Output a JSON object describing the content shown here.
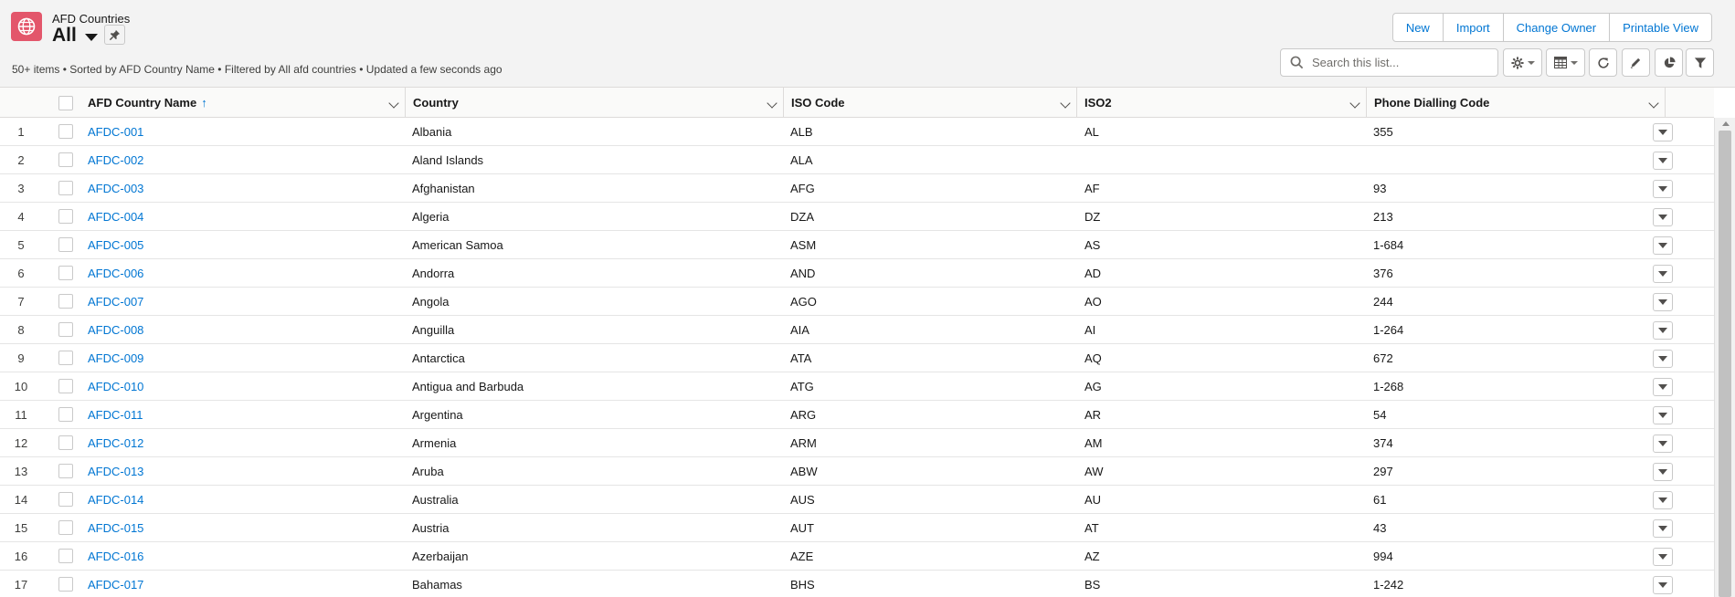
{
  "header": {
    "object_type": "AFD Countries",
    "view_name": "All",
    "meta": "50+ items • Sorted by AFD Country Name • Filtered by All afd countries • Updated a few seconds ago"
  },
  "actions": [
    {
      "name": "new-button",
      "label": "New"
    },
    {
      "name": "import-button",
      "label": "Import"
    },
    {
      "name": "change-owner-button",
      "label": "Change Owner"
    },
    {
      "name": "printable-view-button",
      "label": "Printable View"
    }
  ],
  "search": {
    "placeholder": "Search this list..."
  },
  "columns": {
    "name": "AFD Country Name",
    "country": "Country",
    "iso": "ISO Code",
    "iso2": "ISO2",
    "phone": "Phone Dialling Code",
    "sort_indicator": "↑"
  },
  "rows": [
    {
      "n": "1",
      "name": "AFDC-001",
      "country": "Albania",
      "iso": "ALB",
      "iso2": "AL",
      "phone": "355"
    },
    {
      "n": "2",
      "name": "AFDC-002",
      "country": "Aland Islands",
      "iso": "ALA",
      "iso2": "",
      "phone": ""
    },
    {
      "n": "3",
      "name": "AFDC-003",
      "country": "Afghanistan",
      "iso": "AFG",
      "iso2": "AF",
      "phone": "93"
    },
    {
      "n": "4",
      "name": "AFDC-004",
      "country": "Algeria",
      "iso": "DZA",
      "iso2": "DZ",
      "phone": "213"
    },
    {
      "n": "5",
      "name": "AFDC-005",
      "country": "American Samoa",
      "iso": "ASM",
      "iso2": "AS",
      "phone": "1-684"
    },
    {
      "n": "6",
      "name": "AFDC-006",
      "country": "Andorra",
      "iso": "AND",
      "iso2": "AD",
      "phone": "376"
    },
    {
      "n": "7",
      "name": "AFDC-007",
      "country": "Angola",
      "iso": "AGO",
      "iso2": "AO",
      "phone": "244"
    },
    {
      "n": "8",
      "name": "AFDC-008",
      "country": "Anguilla",
      "iso": "AIA",
      "iso2": "AI",
      "phone": "1-264"
    },
    {
      "n": "9",
      "name": "AFDC-009",
      "country": "Antarctica",
      "iso": "ATA",
      "iso2": "AQ",
      "phone": "672"
    },
    {
      "n": "10",
      "name": "AFDC-010",
      "country": "Antigua and Barbuda",
      "iso": "ATG",
      "iso2": "AG",
      "phone": "1-268"
    },
    {
      "n": "11",
      "name": "AFDC-011",
      "country": "Argentina",
      "iso": "ARG",
      "iso2": "AR",
      "phone": "54"
    },
    {
      "n": "12",
      "name": "AFDC-012",
      "country": "Armenia",
      "iso": "ARM",
      "iso2": "AM",
      "phone": "374"
    },
    {
      "n": "13",
      "name": "AFDC-013",
      "country": "Aruba",
      "iso": "ABW",
      "iso2": "AW",
      "phone": "297"
    },
    {
      "n": "14",
      "name": "AFDC-014",
      "country": "Australia",
      "iso": "AUS",
      "iso2": "AU",
      "phone": "61"
    },
    {
      "n": "15",
      "name": "AFDC-015",
      "country": "Austria",
      "iso": "AUT",
      "iso2": "AT",
      "phone": "43"
    },
    {
      "n": "16",
      "name": "AFDC-016",
      "country": "Azerbaijan",
      "iso": "AZE",
      "iso2": "AZ",
      "phone": "994"
    },
    {
      "n": "17",
      "name": "AFDC-017",
      "country": "Bahamas",
      "iso": "BHS",
      "iso2": "BS",
      "phone": "1-242"
    }
  ],
  "icons": {
    "object": "globe-icon",
    "pin": "pin-icon",
    "search": "search-icon",
    "settings": "gear-icon",
    "display": "table-icon",
    "refresh": "refresh-icon",
    "edit": "pencil-icon",
    "charts": "pie-chart-icon",
    "filter": "filter-icon"
  },
  "colors": {
    "object_icon": "#e3566b",
    "link": "#0176d3",
    "header_bg": "#f3f3f3"
  }
}
